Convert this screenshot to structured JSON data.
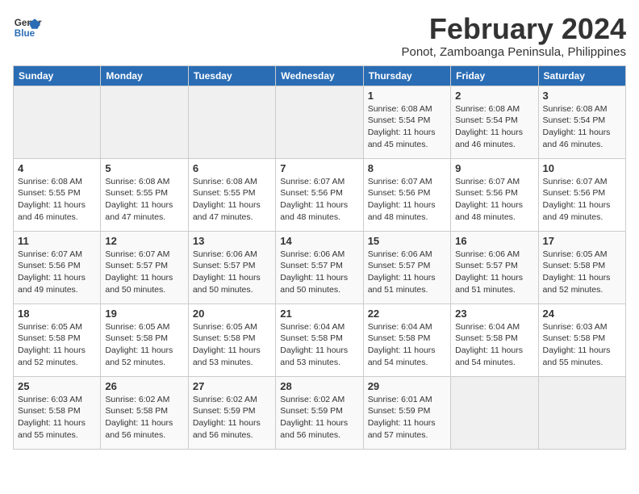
{
  "logo": {
    "line1": "General",
    "line2": "Blue"
  },
  "title": "February 2024",
  "location": "Ponot, Zamboanga Peninsula, Philippines",
  "days_header": [
    "Sunday",
    "Monday",
    "Tuesday",
    "Wednesday",
    "Thursday",
    "Friday",
    "Saturday"
  ],
  "weeks": [
    [
      {
        "day": "",
        "info": ""
      },
      {
        "day": "",
        "info": ""
      },
      {
        "day": "",
        "info": ""
      },
      {
        "day": "",
        "info": ""
      },
      {
        "day": "1",
        "sunrise": "6:08 AM",
        "sunset": "5:54 PM",
        "daylight": "11 hours and 45 minutes."
      },
      {
        "day": "2",
        "sunrise": "6:08 AM",
        "sunset": "5:54 PM",
        "daylight": "11 hours and 46 minutes."
      },
      {
        "day": "3",
        "sunrise": "6:08 AM",
        "sunset": "5:54 PM",
        "daylight": "11 hours and 46 minutes."
      }
    ],
    [
      {
        "day": "4",
        "sunrise": "6:08 AM",
        "sunset": "5:55 PM",
        "daylight": "11 hours and 46 minutes."
      },
      {
        "day": "5",
        "sunrise": "6:08 AM",
        "sunset": "5:55 PM",
        "daylight": "11 hours and 47 minutes."
      },
      {
        "day": "6",
        "sunrise": "6:08 AM",
        "sunset": "5:55 PM",
        "daylight": "11 hours and 47 minutes."
      },
      {
        "day": "7",
        "sunrise": "6:07 AM",
        "sunset": "5:56 PM",
        "daylight": "11 hours and 48 minutes."
      },
      {
        "day": "8",
        "sunrise": "6:07 AM",
        "sunset": "5:56 PM",
        "daylight": "11 hours and 48 minutes."
      },
      {
        "day": "9",
        "sunrise": "6:07 AM",
        "sunset": "5:56 PM",
        "daylight": "11 hours and 48 minutes."
      },
      {
        "day": "10",
        "sunrise": "6:07 AM",
        "sunset": "5:56 PM",
        "daylight": "11 hours and 49 minutes."
      }
    ],
    [
      {
        "day": "11",
        "sunrise": "6:07 AM",
        "sunset": "5:56 PM",
        "daylight": "11 hours and 49 minutes."
      },
      {
        "day": "12",
        "sunrise": "6:07 AM",
        "sunset": "5:57 PM",
        "daylight": "11 hours and 50 minutes."
      },
      {
        "day": "13",
        "sunrise": "6:06 AM",
        "sunset": "5:57 PM",
        "daylight": "11 hours and 50 minutes."
      },
      {
        "day": "14",
        "sunrise": "6:06 AM",
        "sunset": "5:57 PM",
        "daylight": "11 hours and 50 minutes."
      },
      {
        "day": "15",
        "sunrise": "6:06 AM",
        "sunset": "5:57 PM",
        "daylight": "11 hours and 51 minutes."
      },
      {
        "day": "16",
        "sunrise": "6:06 AM",
        "sunset": "5:57 PM",
        "daylight": "11 hours and 51 minutes."
      },
      {
        "day": "17",
        "sunrise": "6:05 AM",
        "sunset": "5:58 PM",
        "daylight": "11 hours and 52 minutes."
      }
    ],
    [
      {
        "day": "18",
        "sunrise": "6:05 AM",
        "sunset": "5:58 PM",
        "daylight": "11 hours and 52 minutes."
      },
      {
        "day": "19",
        "sunrise": "6:05 AM",
        "sunset": "5:58 PM",
        "daylight": "11 hours and 52 minutes."
      },
      {
        "day": "20",
        "sunrise": "6:05 AM",
        "sunset": "5:58 PM",
        "daylight": "11 hours and 53 minutes."
      },
      {
        "day": "21",
        "sunrise": "6:04 AM",
        "sunset": "5:58 PM",
        "daylight": "11 hours and 53 minutes."
      },
      {
        "day": "22",
        "sunrise": "6:04 AM",
        "sunset": "5:58 PM",
        "daylight": "11 hours and 54 minutes."
      },
      {
        "day": "23",
        "sunrise": "6:04 AM",
        "sunset": "5:58 PM",
        "daylight": "11 hours and 54 minutes."
      },
      {
        "day": "24",
        "sunrise": "6:03 AM",
        "sunset": "5:58 PM",
        "daylight": "11 hours and 55 minutes."
      }
    ],
    [
      {
        "day": "25",
        "sunrise": "6:03 AM",
        "sunset": "5:58 PM",
        "daylight": "11 hours and 55 minutes."
      },
      {
        "day": "26",
        "sunrise": "6:02 AM",
        "sunset": "5:58 PM",
        "daylight": "11 hours and 56 minutes."
      },
      {
        "day": "27",
        "sunrise": "6:02 AM",
        "sunset": "5:59 PM",
        "daylight": "11 hours and 56 minutes."
      },
      {
        "day": "28",
        "sunrise": "6:02 AM",
        "sunset": "5:59 PM",
        "daylight": "11 hours and 56 minutes."
      },
      {
        "day": "29",
        "sunrise": "6:01 AM",
        "sunset": "5:59 PM",
        "daylight": "11 hours and 57 minutes."
      },
      {
        "day": "",
        "info": ""
      },
      {
        "day": "",
        "info": ""
      }
    ]
  ]
}
